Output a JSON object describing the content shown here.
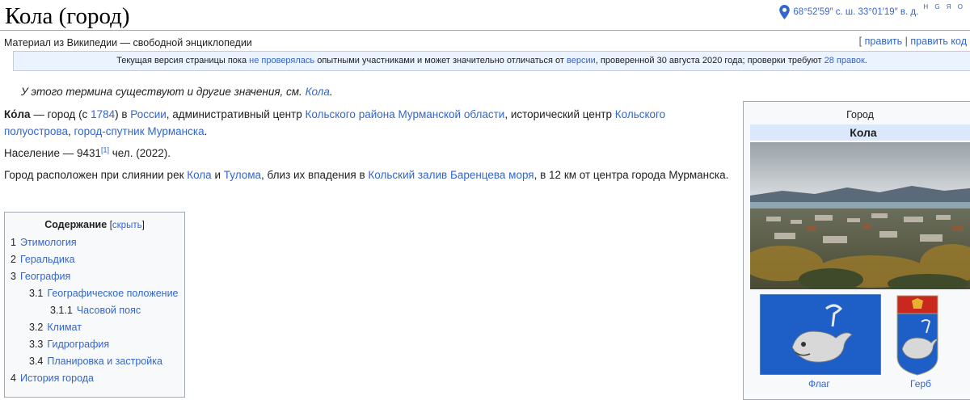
{
  "title": "Кола (город)",
  "subtitle": "Материал из Википедии — свободной энциклопедии",
  "coordinates": {
    "text": "68°52′59″ с. ш. 33°01′19″ в. д.",
    "sup": "H G Я O",
    "icon": "map-pin-icon"
  },
  "edit_links": {
    "open": "[",
    "edit": "править",
    "sep": "|",
    "edit_code": "править код"
  },
  "review_notice": {
    "before": "Текущая версия страницы пока ",
    "link1": "не проверялась",
    "middle": " опытными участниками и может значительно отличаться от ",
    "link2": "версии",
    "after": ", проверенной 30 августа 2020 года; проверки требуют ",
    "link3": "28 правок",
    "end": "."
  },
  "hatnote": {
    "text": "У этого термина существуют и другие значения, см. ",
    "link": "Кола",
    "end": "."
  },
  "intro": {
    "bold": "Ко́ла",
    "t1": " — город (с ",
    "l1": "1784",
    "t2": ") в ",
    "l2": "России",
    "t3": ", административный центр ",
    "l3": "Кольского района",
    "t4": " ",
    "l4": "Мурманской области",
    "t5": ", исторический центр ",
    "l5": "Кольского полуострова",
    "t6": ", ",
    "l6": "город-спутник Мурманска",
    "t7": "."
  },
  "population": {
    "text": "Население — 9431",
    "ref": "[1]",
    "end": " чел. (2022)."
  },
  "geo": {
    "t1": "Город расположен при слиянии рек ",
    "l1": "Кола",
    "t2": " и ",
    "l2": "Тулома",
    "t3": ", близ их впадения в ",
    "l3": "Кольский залив",
    "t4": " ",
    "l4": "Баренцева моря",
    "t5": ", в 12 км от центра города Мурманска."
  },
  "toc": {
    "title": "Содержание",
    "toggle_open": "[",
    "toggle": "скрыть",
    "toggle_close": "]",
    "items": [
      {
        "num": "1",
        "label": "Этимология"
      },
      {
        "num": "2",
        "label": "Геральдика"
      },
      {
        "num": "3",
        "label": "География"
      },
      {
        "num": "3.1",
        "label": "Географическое положение"
      },
      {
        "num": "3.1.1",
        "label": "Часовой пояс"
      },
      {
        "num": "3.2",
        "label": "Климат"
      },
      {
        "num": "3.3",
        "label": "Гидрография"
      },
      {
        "num": "3.4",
        "label": "Планировка и застройка"
      },
      {
        "num": "4",
        "label": "История города"
      }
    ]
  },
  "infobox": {
    "type": "Город",
    "name": "Кола",
    "flag_caption": "Флаг",
    "coat_caption": "Герб"
  },
  "colors": {
    "link": "#3366cc",
    "notice_bg": "#eaf3ff",
    "infobox_header_bg": "#dbe8fb",
    "flag_blue": "#1d5fc6"
  }
}
